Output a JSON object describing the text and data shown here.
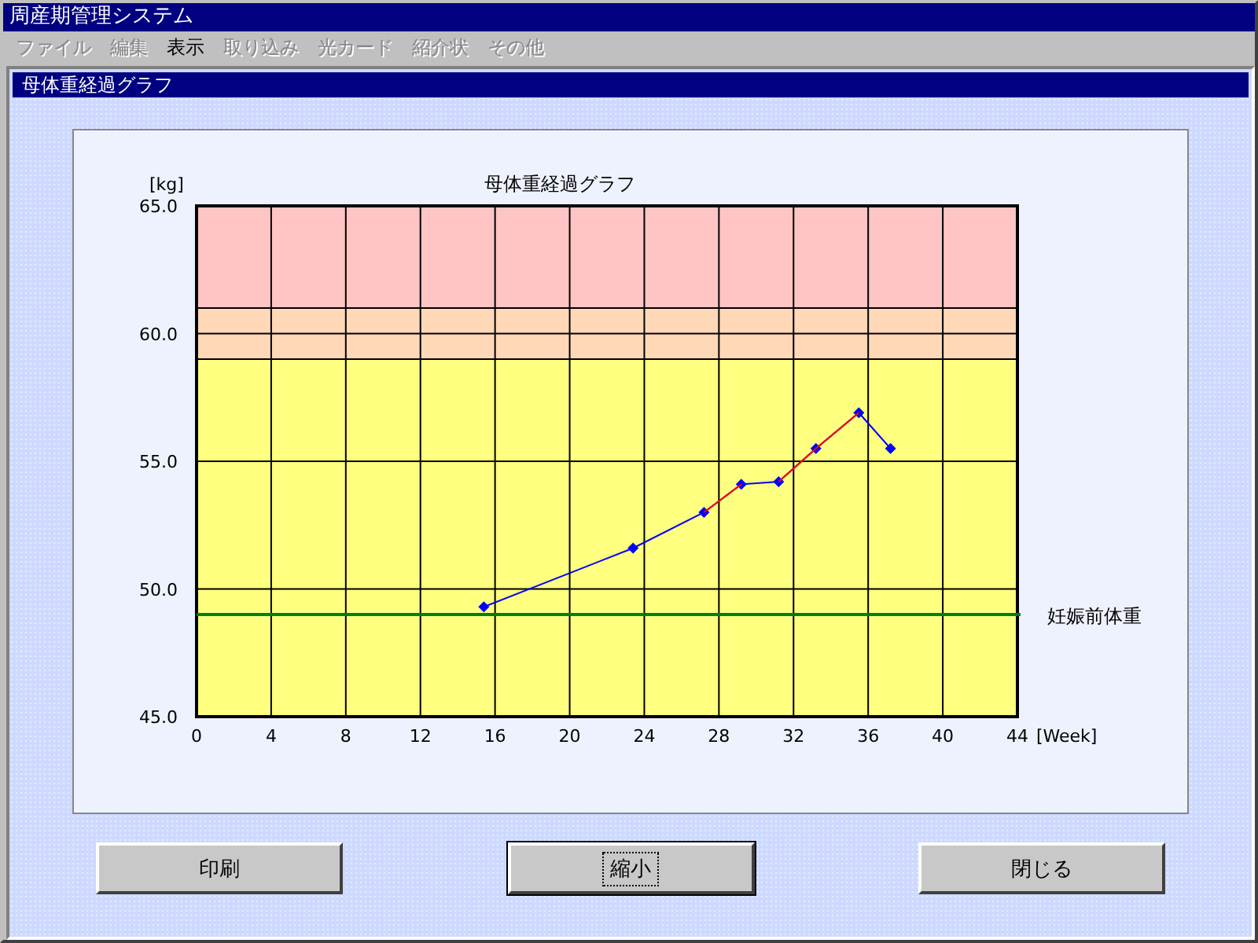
{
  "window": {
    "title": "周産期管理システム"
  },
  "menu": [
    {
      "label": "ファイル",
      "disabled": true
    },
    {
      "label": "編集",
      "disabled": true
    },
    {
      "label": "表示",
      "disabled": false
    },
    {
      "label": "取り込み",
      "disabled": true
    },
    {
      "label": "光カード",
      "disabled": true
    },
    {
      "label": "紹介状",
      "disabled": true
    },
    {
      "label": "その他",
      "disabled": true
    }
  ],
  "panel": {
    "title": "母体重経過グラフ"
  },
  "chart": {
    "chart_data": {
      "type": "line",
      "title": "母体重経過グラフ",
      "xlabel": "[Week]",
      "ylabel": "[kg]",
      "grid": true,
      "x": [
        15.4,
        23.4,
        27.2,
        29.2,
        31.2,
        33.2,
        35.5,
        37.2
      ],
      "series": [
        {
          "color": "#0000ff",
          "marker": "diamond",
          "values": [
            49.3,
            51.6,
            53.0,
            54.1,
            54.2,
            55.5,
            56.9,
            55.5
          ]
        },
        {
          "color": "#ff0000",
          "values": [
            null,
            null,
            53.0,
            54.1,
            null,
            null,
            null,
            null
          ]
        },
        {
          "color": "#ff0000",
          "values": [
            null,
            null,
            null,
            null,
            54.2,
            55.5,
            56.9,
            null
          ]
        }
      ],
      "xlim": [
        0,
        44
      ],
      "ylim": [
        45,
        65
      ],
      "xticks": [
        0,
        4,
        8,
        12,
        16,
        20,
        24,
        28,
        32,
        36,
        40,
        44
      ],
      "yticks": [
        {
          "value": 45,
          "label": "45.0"
        },
        {
          "value": 50,
          "label": "50.0"
        },
        {
          "value": 55,
          "label": "55.0"
        },
        {
          "value": 60,
          "label": "60.0"
        },
        {
          "value": 65,
          "label": "65.0"
        }
      ],
      "bands": [
        {
          "axis": "y",
          "from": 61,
          "to": 65,
          "color": "#ffc4c4"
        },
        {
          "axis": "y",
          "from": 59,
          "to": 61,
          "color": "#ffd8b8"
        },
        {
          "axis": "y",
          "from": 45,
          "to": 59,
          "color": "#ffff80"
        }
      ],
      "ref_lines": [
        {
          "axis": "y",
          "value": 49,
          "color": "#008000",
          "label": "妊娠前体重"
        }
      ]
    }
  },
  "buttons": [
    {
      "label": "印刷",
      "focused": false
    },
    {
      "label": "縮小",
      "focused": true
    },
    {
      "label": "閉じる",
      "focused": false
    }
  ]
}
